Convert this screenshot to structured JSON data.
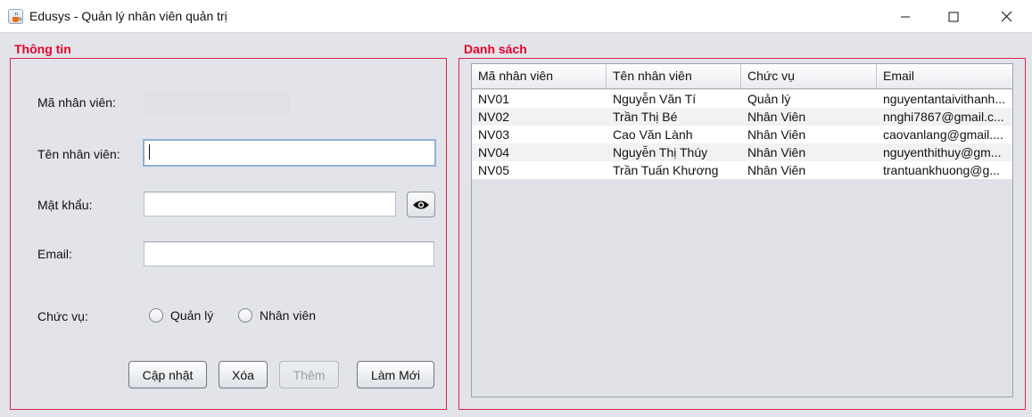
{
  "window": {
    "title": "Edusys - Quản lý nhân viên quản trị",
    "icon": "java-coffee-icon"
  },
  "info_panel": {
    "title": "Thông tin",
    "fields": {
      "ma_nv_label": "Mã nhân viên:",
      "ma_nv_value": "",
      "ten_nv_label": "Tên nhân viên:",
      "ten_nv_value": "",
      "mat_khau_label": "Mật khẩu:",
      "mat_khau_value": "",
      "email_label": "Email:",
      "email_value": "",
      "chuc_vu_label": "Chức vụ:"
    },
    "roles": [
      "Quản lý",
      "Nhân viên"
    ],
    "buttons": {
      "update": "Cập nhật",
      "delete": "Xóa",
      "add": "Thêm",
      "reset": "Làm Mới"
    }
  },
  "list_panel": {
    "title": "Danh sách",
    "columns": [
      "Mã nhân viên",
      "Tên nhân viên",
      "Chức vụ",
      "Email"
    ],
    "rows": [
      [
        "NV01",
        "Nguyễn Văn Tí",
        "Quản lý",
        "nguyentantaivithanh..."
      ],
      [
        "NV02",
        "Trần Thị Bé",
        "Nhân Viên",
        "nnghi7867@gmail.c..."
      ],
      [
        "NV03",
        "Cao Văn Lành",
        "Nhân Viên",
        "caovanlang@gmail...."
      ],
      [
        "NV04",
        "Nguyễn Thị Thúy",
        "Nhân Viên",
        "nguyenthithuy@gm..."
      ],
      [
        "NV05",
        "Trần Tuấn Khương",
        "Nhân Viên",
        "trantuankhuong@g..."
      ]
    ]
  },
  "colors": {
    "accent_red": "#e8002a",
    "background": "#e2e4ea"
  }
}
